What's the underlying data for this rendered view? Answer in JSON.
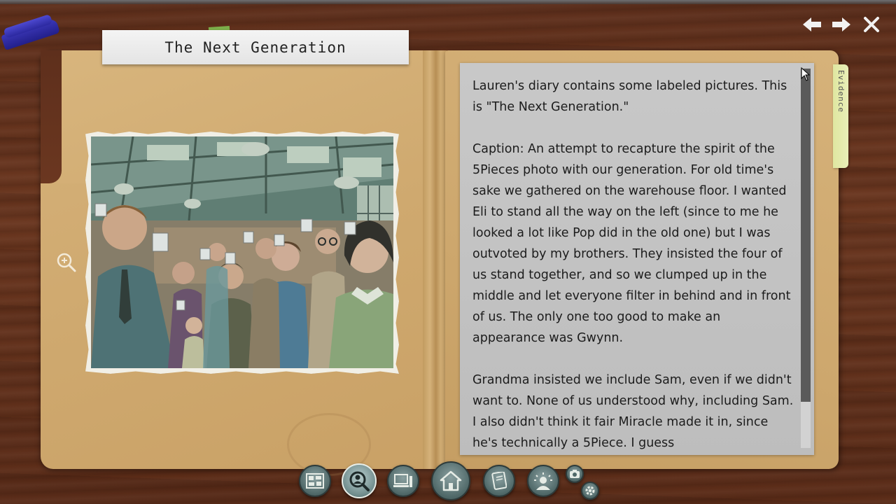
{
  "document": {
    "title": "The Next Generation",
    "paragraphs": [
      "Lauren's diary contains some labeled pictures. This is \"The Next Generation.\"",
      "Caption: An attempt to recapture the spirit of the 5Pieces photo with our generation. For old time's sake we gathered on the warehouse floor. I wanted Eli to stand all the way on the left (since to me he looked a lot like Pop did in the old one) but I was outvoted by my brothers. They insisted the four of us stand together, and so we clumped up in the middle and let everyone filter in behind and in front of us. The only one too good to make an appearance was Gwynn.",
      "Grandma insisted we include Sam, even if we didn't want to. None of us understood why, including Sam. I also didn't think it fair Miracle made it in, since he's technically a 5Piece. I guess"
    ]
  },
  "tabs": {
    "evidence_label": "Evidence"
  },
  "photo": {
    "description_icon": "group-photo-image"
  },
  "navigation": {
    "back_icon": "arrow-left-icon",
    "forward_icon": "arrow-right-icon",
    "close_icon": "close-icon"
  },
  "toolbar": {
    "buttons": [
      {
        "id": "evidence-board",
        "icon": "board-icon",
        "active": false
      },
      {
        "id": "investigate",
        "icon": "magnifier-person-icon",
        "active": true
      },
      {
        "id": "computer",
        "icon": "computer-icon",
        "active": false
      },
      {
        "id": "home",
        "icon": "home-icon",
        "active": false
      },
      {
        "id": "notebook",
        "icon": "notebook-icon",
        "active": false
      },
      {
        "id": "hints",
        "icon": "lightbulb-person-icon",
        "active": false
      },
      {
        "id": "screenshot",
        "icon": "camera-icon",
        "active": false
      },
      {
        "id": "settings",
        "icon": "gear-icon",
        "active": false
      }
    ]
  },
  "colors": {
    "wood": "#6b3720",
    "folder": "#d6b27a",
    "panel": "#c4c4c4",
    "toolbar_button": "#5f7a7a",
    "evidence_tab": "#e4eaac"
  }
}
